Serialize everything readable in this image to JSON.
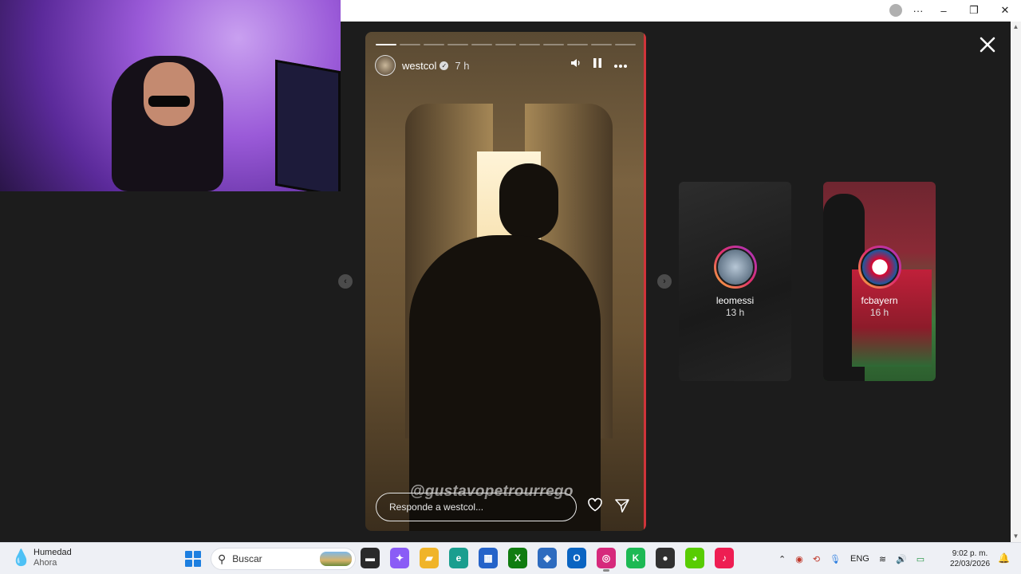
{
  "browser": {
    "controls": {
      "menu": "···",
      "minimize": "–",
      "restore": "❐",
      "close": "✕"
    }
  },
  "story": {
    "username": "westcol",
    "verified_glyph": "✓",
    "age": "7 h",
    "segments": 11,
    "active_segment": 1,
    "mention": "@gustavopetrourrego",
    "reply_placeholder": "Responde a westcol...",
    "icons": [
      "volume-icon",
      "pause-icon",
      "more-icon",
      "heart-icon",
      "send-icon",
      "close-icon"
    ]
  },
  "previews": [
    {
      "username": "leomessi",
      "age": "13 h"
    },
    {
      "username": "fcbayern",
      "age": "16 h"
    }
  ],
  "taskbar": {
    "weather_title": "Humedad",
    "weather_sub": "Ahora",
    "search_label": "Buscar",
    "language": "ENG",
    "time": "9:02 p. m.",
    "date": "22/03/2026",
    "apps": [
      {
        "name": "file-manager-app",
        "color": "#2a2a2a",
        "glyph": "▬"
      },
      {
        "name": "copilot-app",
        "color": "#8a5cf6",
        "glyph": "✦"
      },
      {
        "name": "file-explorer-app",
        "color": "#f0b429",
        "glyph": "▰"
      },
      {
        "name": "edge-app",
        "color": "#1a9e8f",
        "glyph": "e"
      },
      {
        "name": "store-app",
        "color": "#2563c9",
        "glyph": "▦"
      },
      {
        "name": "xbox-app",
        "color": "#107c10",
        "glyph": "X"
      },
      {
        "name": "virtualbox-app",
        "color": "#2d6bbf",
        "glyph": "◈"
      },
      {
        "name": "outlook-app",
        "color": "#0a64c2",
        "glyph": "O"
      },
      {
        "name": "instagram-app",
        "color": "#d6297c",
        "glyph": "◎"
      },
      {
        "name": "kick-app",
        "color": "#1db954",
        "glyph": "K"
      },
      {
        "name": "obs-app",
        "color": "#303030",
        "glyph": "●"
      },
      {
        "name": "duolingo-app",
        "color": "#58cc02",
        "glyph": "◕"
      },
      {
        "name": "tiktok-app",
        "color": "#ee1d52",
        "glyph": "♪"
      }
    ]
  }
}
